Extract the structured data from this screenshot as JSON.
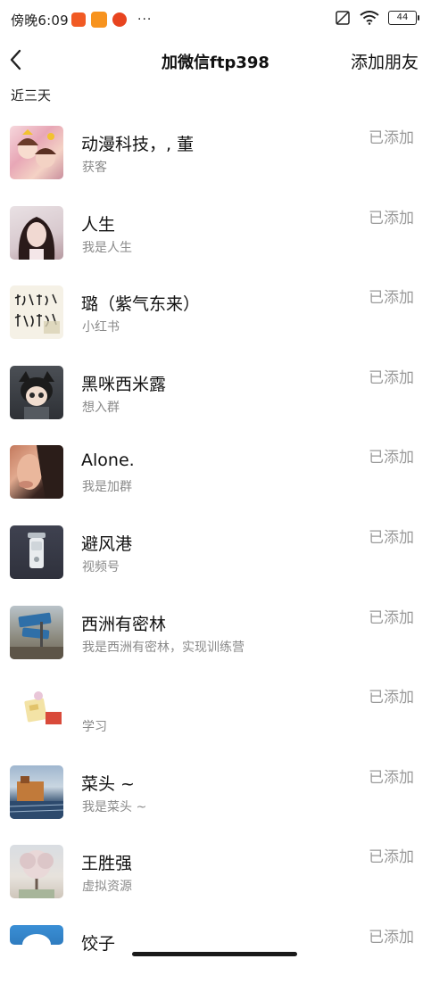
{
  "status_bar": {
    "time": "傍晚6:09",
    "dots": "···",
    "battery": "44"
  },
  "header": {
    "title": "加微信ftp398",
    "action_label": "添加朋友"
  },
  "section": {
    "label": "近三天"
  },
  "friends": [
    {
      "name": "动漫科技，, 董",
      "subtitle": "获客",
      "status": "已添加"
    },
    {
      "name": "人生",
      "subtitle": "我是人生",
      "status": "已添加"
    },
    {
      "name": "璐（紫气东来）",
      "subtitle": "小红书",
      "status": "已添加"
    },
    {
      "name": "黑咪西米露",
      "subtitle": "想入群",
      "status": "已添加"
    },
    {
      "name": "Alone.",
      "subtitle": "我是加群",
      "status": "已添加"
    },
    {
      "name": "避风港",
      "subtitle": "视频号",
      "status": "已添加"
    },
    {
      "name": "西洲有密林",
      "subtitle": "我是西洲有密林，实现训练营",
      "status": "已添加"
    },
    {
      "name": "",
      "subtitle": "学习",
      "status": "已添加"
    },
    {
      "name": "菜头 ~",
      "subtitle": "我是菜头 ~",
      "status": "已添加"
    },
    {
      "name": "王胜强",
      "subtitle": "虚拟资源",
      "status": "已添加"
    },
    {
      "name": "饺子",
      "subtitle": "",
      "status": "已添加"
    }
  ],
  "colors": {
    "status_gray": "#9a9a9a",
    "subtitle_gray": "#8a8a8a"
  }
}
